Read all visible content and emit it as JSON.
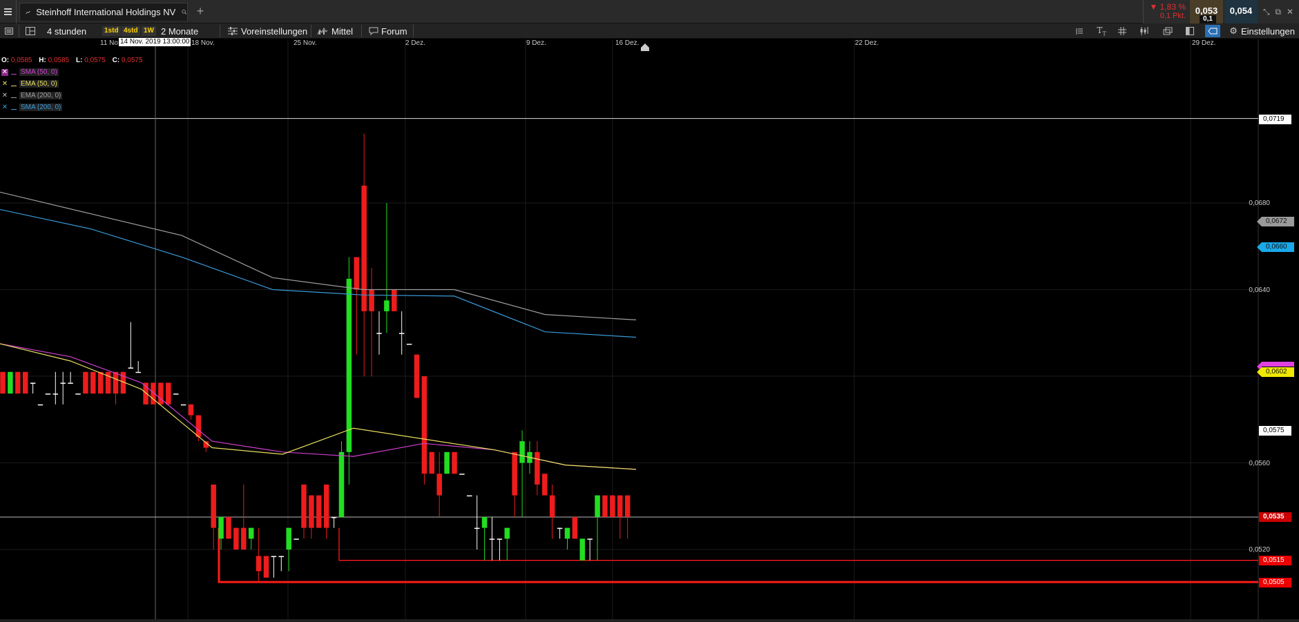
{
  "tabbar": {
    "instrument_title": "Steinhoff International Holdings NV",
    "add_tab_symbol": "+",
    "change_pct": "▼ 1,83 %",
    "change_pts": "0,1 Pkt.",
    "bid": "0,053",
    "ask": "0,054",
    "spread": "0,1"
  },
  "toolbar": {
    "interval_label": "4 stunden",
    "intervals": [
      "1std",
      "4std",
      "1W"
    ],
    "range_label": "2 Monate",
    "presets_label": "Voreinstellungen",
    "indicator_label": "Mittel",
    "forum_label": "Forum",
    "settings_label": "Einstellungen"
  },
  "xaxis": {
    "labels": [
      "11 No",
      "18 Nov.",
      "25 Nov.",
      "2 Dez.",
      "9 Dez.",
      "16 Dez.",
      "22 Dez.",
      "29 Dez."
    ],
    "crosshair_date": "14 Nov. 2019 13:00:00"
  },
  "ohlc": {
    "o_label": "O:",
    "o_value": "0,0585",
    "h_label": "H:",
    "h_value": "0,0585",
    "l_label": "L:",
    "l_value": "0,0575",
    "c_label": "C:",
    "c_value": "0,0575"
  },
  "indicators": [
    {
      "name": "SMA (50, 0)",
      "color": "#d040d0"
    },
    {
      "name": "EMA (50, 0)",
      "color": "#e8e060"
    },
    {
      "name": "EMA (200, 0)",
      "color": "#a0a0a0"
    },
    {
      "name": "SMA (200, 0)",
      "color": "#3a9ad8"
    }
  ],
  "yaxis": {
    "labels": [
      "0,0680",
      "0,0640",
      "0,0560",
      "0,0520"
    ],
    "tags": {
      "hline_top": "0,0719",
      "ema200": "0,0672",
      "sma200": "0,0660",
      "ema50": "0,0602",
      "last": "0,0575",
      "crosshair": "0,0535",
      "support1": "0,0515",
      "support2": "0,0505"
    }
  },
  "colors": {
    "up": "#22dd22",
    "down": "#ee1c1c",
    "doji": "#ffffff",
    "sma50": "#d040d0",
    "ema50": "#e8e060",
    "ema200": "#a0a0a0",
    "sma200": "#3a9ad8",
    "support": "#ff1a1a"
  },
  "chart_data": {
    "type": "candlestick",
    "timeframe": "4 stunden",
    "price_range": [
      0.05,
      0.0722
    ],
    "candles": [
      {
        "o": 0.0602,
        "h": 0.0602,
        "l": 0.0592,
        "c": 0.0592
      },
      {
        "o": 0.0592,
        "h": 0.0602,
        "l": 0.0592,
        "c": 0.0602
      },
      {
        "o": 0.0602,
        "h": 0.0602,
        "l": 0.0592,
        "c": 0.0592
      },
      {
        "o": 0.0602,
        "h": 0.0602,
        "l": 0.0592,
        "c": 0.0592
      },
      {
        "o": 0.0597,
        "h": 0.0597,
        "l": 0.0592,
        "c": 0.0597
      },
      {
        "o": 0.0587,
        "h": 0.0587,
        "l": 0.0587,
        "c": 0.0587
      },
      {
        "o": 0.0592,
        "h": 0.0592,
        "l": 0.0592,
        "c": 0.0592
      },
      {
        "o": 0.0592,
        "h": 0.0602,
        "l": 0.0587,
        "c": 0.0592
      },
      {
        "o": 0.0597,
        "h": 0.0602,
        "l": 0.0587,
        "c": 0.0597
      },
      {
        "o": 0.0597,
        "h": 0.0602,
        "l": 0.0597,
        "c": 0.0597
      },
      {
        "o": 0.0592,
        "h": 0.0592,
        "l": 0.0592,
        "c": 0.0592
      },
      {
        "o": 0.0602,
        "h": 0.0602,
        "l": 0.0592,
        "c": 0.0592
      },
      {
        "o": 0.0602,
        "h": 0.0602,
        "l": 0.0592,
        "c": 0.0592
      },
      {
        "o": 0.0602,
        "h": 0.0602,
        "l": 0.0592,
        "c": 0.0592
      },
      {
        "o": 0.0602,
        "h": 0.0602,
        "l": 0.0592,
        "c": 0.0592
      },
      {
        "o": 0.0602,
        "h": 0.0602,
        "l": 0.0587,
        "c": 0.0592
      },
      {
        "o": 0.0602,
        "h": 0.0602,
        "l": 0.0592,
        "c": 0.0592
      },
      {
        "o": 0.0604,
        "h": 0.0625,
        "l": 0.0604,
        "c": 0.0604
      },
      {
        "o": 0.0602,
        "h": 0.0607,
        "l": 0.0602,
        "c": 0.0602
      },
      {
        "o": 0.0597,
        "h": 0.0597,
        "l": 0.0587,
        "c": 0.0587
      },
      {
        "o": 0.0597,
        "h": 0.0597,
        "l": 0.0587,
        "c": 0.0587
      },
      {
        "o": 0.0597,
        "h": 0.0597,
        "l": 0.0587,
        "c": 0.0587
      },
      {
        "o": 0.0597,
        "h": 0.0597,
        "l": 0.0587,
        "c": 0.0587
      },
      {
        "o": 0.0592,
        "h": 0.0592,
        "l": 0.0592,
        "c": 0.0592
      },
      {
        "o": 0.0587,
        "h": 0.0587,
        "l": 0.0587,
        "c": 0.0587
      },
      {
        "o": 0.0587,
        "h": 0.0587,
        "l": 0.058,
        "c": 0.0582
      },
      {
        "o": 0.0582,
        "h": 0.0582,
        "l": 0.057,
        "c": 0.0572
      },
      {
        "o": 0.057,
        "h": 0.057,
        "l": 0.0565,
        "c": 0.0567
      },
      {
        "o": 0.055,
        "h": 0.055,
        "l": 0.052,
        "c": 0.053
      },
      {
        "o": 0.0525,
        "h": 0.0535,
        "l": 0.052,
        "c": 0.0535
      },
      {
        "o": 0.0535,
        "h": 0.0535,
        "l": 0.0525,
        "c": 0.0525
      },
      {
        "o": 0.053,
        "h": 0.053,
        "l": 0.052,
        "c": 0.052
      },
      {
        "o": 0.053,
        "h": 0.055,
        "l": 0.052,
        "c": 0.052
      },
      {
        "o": 0.0525,
        "h": 0.053,
        "l": 0.052,
        "c": 0.053
      },
      {
        "o": 0.0517,
        "h": 0.053,
        "l": 0.0505,
        "c": 0.051
      },
      {
        "o": 0.0517,
        "h": 0.0517,
        "l": 0.0507,
        "c": 0.0507
      },
      {
        "o": 0.0517,
        "h": 0.0517,
        "l": 0.0507,
        "c": 0.0517
      },
      {
        "o": 0.0517,
        "h": 0.0517,
        "l": 0.051,
        "c": 0.0517
      },
      {
        "o": 0.052,
        "h": 0.053,
        "l": 0.051,
        "c": 0.053
      },
      {
        "o": 0.0525,
        "h": 0.0525,
        "l": 0.0525,
        "c": 0.0525
      },
      {
        "o": 0.055,
        "h": 0.055,
        "l": 0.0525,
        "c": 0.053
      },
      {
        "o": 0.0545,
        "h": 0.0545,
        "l": 0.0525,
        "c": 0.053
      },
      {
        "o": 0.0545,
        "h": 0.0545,
        "l": 0.053,
        "c": 0.053
      },
      {
        "o": 0.055,
        "h": 0.055,
        "l": 0.0525,
        "c": 0.053
      },
      {
        "o": 0.0535,
        "h": 0.0535,
        "l": 0.053,
        "c": 0.0535
      },
      {
        "o": 0.0535,
        "h": 0.057,
        "l": 0.0535,
        "c": 0.0565
      },
      {
        "o": 0.0565,
        "h": 0.0655,
        "l": 0.055,
        "c": 0.0645
      },
      {
        "o": 0.0655,
        "h": 0.0655,
        "l": 0.061,
        "c": 0.064
      },
      {
        "o": 0.0688,
        "h": 0.0712,
        "l": 0.06,
        "c": 0.063
      },
      {
        "o": 0.064,
        "h": 0.065,
        "l": 0.06,
        "c": 0.063
      },
      {
        "o": 0.062,
        "h": 0.063,
        "l": 0.061,
        "c": 0.062
      },
      {
        "o": 0.063,
        "h": 0.068,
        "l": 0.062,
        "c": 0.0635
      },
      {
        "o": 0.064,
        "h": 0.064,
        "l": 0.063,
        "c": 0.063
      },
      {
        "o": 0.062,
        "h": 0.063,
        "l": 0.061,
        "c": 0.062
      },
      {
        "o": 0.0615,
        "h": 0.0615,
        "l": 0.0615,
        "c": 0.0615
      },
      {
        "o": 0.061,
        "h": 0.061,
        "l": 0.059,
        "c": 0.059
      },
      {
        "o": 0.06,
        "h": 0.06,
        "l": 0.055,
        "c": 0.0555
      },
      {
        "o": 0.0565,
        "h": 0.0565,
        "l": 0.0555,
        "c": 0.0555
      },
      {
        "o": 0.0555,
        "h": 0.0565,
        "l": 0.0535,
        "c": 0.0545
      },
      {
        "o": 0.0555,
        "h": 0.0565,
        "l": 0.0555,
        "c": 0.0565
      },
      {
        "o": 0.0565,
        "h": 0.0565,
        "l": 0.0555,
        "c": 0.0555
      },
      {
        "o": 0.0555,
        "h": 0.0555,
        "l": 0.0555,
        "c": 0.0555
      },
      {
        "o": 0.0545,
        "h": 0.0545,
        "l": 0.0545,
        "c": 0.0545
      },
      {
        "o": 0.053,
        "h": 0.0545,
        "l": 0.052,
        "c": 0.053
      },
      {
        "o": 0.053,
        "h": 0.0535,
        "l": 0.0515,
        "c": 0.0535
      },
      {
        "o": 0.0525,
        "h": 0.0535,
        "l": 0.0515,
        "c": 0.0525
      },
      {
        "o": 0.0525,
        "h": 0.0525,
        "l": 0.0515,
        "c": 0.0525
      },
      {
        "o": 0.0525,
        "h": 0.053,
        "l": 0.0515,
        "c": 0.053
      },
      {
        "o": 0.0565,
        "h": 0.0565,
        "l": 0.0535,
        "c": 0.0545
      },
      {
        "o": 0.056,
        "h": 0.0575,
        "l": 0.0535,
        "c": 0.057
      },
      {
        "o": 0.056,
        "h": 0.057,
        "l": 0.0555,
        "c": 0.0565
      },
      {
        "o": 0.0565,
        "h": 0.057,
        "l": 0.0545,
        "c": 0.055
      },
      {
        "o": 0.0555,
        "h": 0.0555,
        "l": 0.0545,
        "c": 0.0545
      },
      {
        "o": 0.0545,
        "h": 0.055,
        "l": 0.0525,
        "c": 0.0535
      },
      {
        "o": 0.053,
        "h": 0.053,
        "l": 0.0525,
        "c": 0.053
      },
      {
        "o": 0.0525,
        "h": 0.053,
        "l": 0.052,
        "c": 0.053
      },
      {
        "o": 0.0535,
        "h": 0.0535,
        "l": 0.0525,
        "c": 0.0525
      },
      {
        "o": 0.0515,
        "h": 0.0525,
        "l": 0.0515,
        "c": 0.0525
      },
      {
        "o": 0.0525,
        "h": 0.0525,
        "l": 0.0515,
        "c": 0.0525
      },
      {
        "o": 0.0535,
        "h": 0.0545,
        "l": 0.0515,
        "c": 0.0545
      },
      {
        "o": 0.0545,
        "h": 0.0545,
        "l": 0.0535,
        "c": 0.0535
      },
      {
        "o": 0.0545,
        "h": 0.0545,
        "l": 0.0535,
        "c": 0.0535
      },
      {
        "o": 0.0545,
        "h": 0.0545,
        "l": 0.0525,
        "c": 0.0535
      },
      {
        "o": 0.0545,
        "h": 0.0545,
        "l": 0.0525,
        "c": 0.0535
      }
    ],
    "ma_lines": {
      "ema200": [
        0.0685,
        0.0675,
        0.0665,
        0.06455,
        0.064,
        0.064,
        0.06285,
        0.0626
      ],
      "sma200": [
        0.0677,
        0.0668,
        0.0655,
        0.064,
        0.06375,
        0.0637,
        0.06205,
        0.0618
      ],
      "sma50": [
        0.0615,
        0.0609,
        0.0597,
        0.057,
        0.0565,
        0.0563,
        0.0569,
        0.0566,
        0.0559,
        0.0557
      ],
      "ema50": [
        0.0615,
        0.0607,
        0.0594,
        0.0567,
        0.0564,
        0.0576,
        0.0571,
        0.0566,
        0.0559,
        0.0557
      ]
    },
    "support_lines": [
      0.0515,
      0.0505
    ],
    "crosshair_price": 0.0535
  }
}
